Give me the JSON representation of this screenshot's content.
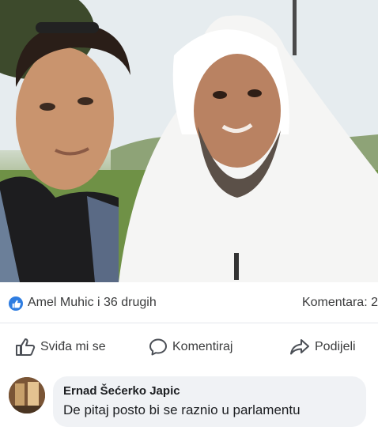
{
  "post": {
    "photo_icon": "photo-two-men-selfie",
    "reactions": {
      "icon": "like-icon",
      "text": "Amel Muhic i 36 drugih",
      "comments_text": "Komentara: 2"
    },
    "actions": [
      {
        "label": "Sviđa mi se",
        "icon": "thumbs-up-icon"
      },
      {
        "label": "Komentiraj",
        "icon": "comment-icon"
      },
      {
        "label": "Podijeli",
        "icon": "share-icon"
      }
    ],
    "comment": {
      "author": "Ernad Šećerko Japic",
      "text": "De pitaj posto bi se raznio u parlamentu"
    }
  },
  "colors": {
    "like_blue": "#2f7de1",
    "bubble": "#f0f2f5",
    "text": "#1c1e21"
  }
}
